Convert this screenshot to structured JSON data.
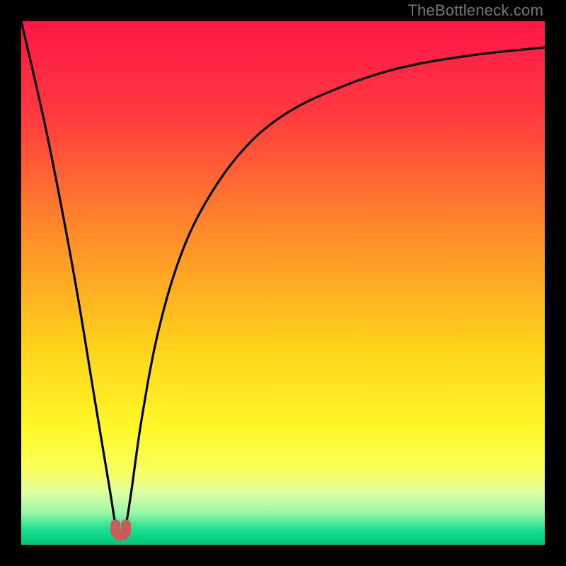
{
  "watermark": "TheBottleneck.com",
  "chart_data": {
    "type": "line",
    "title": "",
    "xlabel": "",
    "ylabel": "",
    "xlim": [
      0,
      100
    ],
    "ylim": [
      0,
      100
    ],
    "grid": false,
    "legend": false,
    "optimum_x": 19,
    "minimum_y": 2,
    "series": [
      {
        "name": "bottleneck-curve",
        "x": [
          0,
          5,
          10,
          14,
          17,
          18,
          19,
          20,
          21,
          23,
          26,
          30,
          35,
          42,
          50,
          60,
          72,
          86,
          100
        ],
        "values": [
          100,
          78,
          52,
          28,
          10,
          4,
          2,
          4,
          10,
          24,
          40,
          54,
          65,
          75,
          82,
          87,
          91,
          93.5,
          95
        ]
      }
    ],
    "gradient_stops": [
      {
        "offset": 0,
        "color": "#ff1748"
      },
      {
        "offset": 18,
        "color": "#ff3a3f"
      },
      {
        "offset": 40,
        "color": "#ff8a2a"
      },
      {
        "offset": 62,
        "color": "#ffd21a"
      },
      {
        "offset": 78,
        "color": "#fff92a"
      },
      {
        "offset": 86,
        "color": "#f6ff60"
      },
      {
        "offset": 90,
        "color": "#dfffa2"
      },
      {
        "offset": 94,
        "color": "#97f7a8"
      },
      {
        "offset": 97,
        "color": "#1ee090"
      },
      {
        "offset": 100,
        "color": "#00c878"
      }
    ],
    "dip_marker": {
      "color": "#cc5a57",
      "y": 2,
      "x_start": 18,
      "x_end": 20
    }
  }
}
